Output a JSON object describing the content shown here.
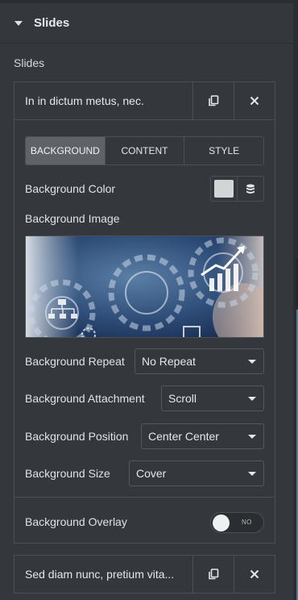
{
  "section": {
    "title": "Slides"
  },
  "repeater": {
    "label": "Slides",
    "items": [
      {
        "title": "In in dictum metus, nec."
      },
      {
        "title": "Sed diam nunc, pretium vita..."
      }
    ]
  },
  "tabs": [
    {
      "label": "BACKGROUND",
      "active": true
    },
    {
      "label": "CONTENT",
      "active": false
    },
    {
      "label": "STYLE",
      "active": false
    }
  ],
  "fields": {
    "bg_color": {
      "label": "Background Color",
      "swatch": "#d2d4d6"
    },
    "bg_image": {
      "label": "Background Image"
    },
    "bg_repeat": {
      "label": "Background Repeat",
      "value": "No Repeat"
    },
    "bg_attachment": {
      "label": "Background Attachment",
      "value": "Scroll"
    },
    "bg_position": {
      "label": "Background Position",
      "value": "Center Center"
    },
    "bg_size": {
      "label": "Background Size",
      "value": "Cover"
    },
    "bg_overlay": {
      "label": "Background Overlay",
      "state": "NO"
    }
  },
  "icons": {
    "caret": "caret-down-icon",
    "duplicate": "copy-icon",
    "remove": "close-icon",
    "global": "database-icon"
  },
  "colors": {
    "panel_bg": "#34383c",
    "border": "#4b5055",
    "active_tab": "#5f6368",
    "text": "#e0e1e3"
  }
}
